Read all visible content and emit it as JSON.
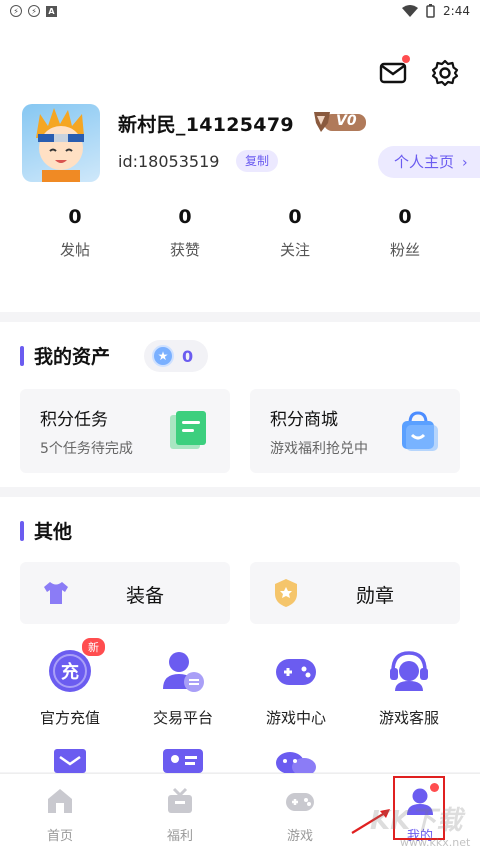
{
  "status_bar": {
    "time": "2:44"
  },
  "profile": {
    "username": "新村民_14125479",
    "vip_label": "V0",
    "uid": "id:18053519",
    "copy_label": "复制",
    "homepage_label": "个人主页",
    "stats": [
      {
        "value": "0",
        "label": "发帖"
      },
      {
        "value": "0",
        "label": "获赞"
      },
      {
        "value": "0",
        "label": "关注"
      },
      {
        "value": "0",
        "label": "粉丝"
      }
    ]
  },
  "assets": {
    "title": "我的资产",
    "coin_value": "0",
    "tiles": [
      {
        "title": "积分任务",
        "subtitle": "5个任务待完成",
        "icon": "task-list-icon"
      },
      {
        "title": "积分商城",
        "subtitle": "游戏福利抢兑中",
        "icon": "shopping-bag-icon"
      }
    ]
  },
  "other": {
    "title": "其他",
    "buttons": [
      {
        "label": "装备",
        "icon": "tshirt-icon"
      },
      {
        "label": "勋章",
        "icon": "medal-icon"
      }
    ],
    "grid": [
      {
        "label": "官方充值",
        "icon": "recharge-icon",
        "badge": "新"
      },
      {
        "label": "交易平台",
        "icon": "trade-icon"
      },
      {
        "label": "游戏中心",
        "icon": "gamepad-icon"
      },
      {
        "label": "游戏客服",
        "icon": "headset-icon"
      }
    ]
  },
  "tabbar": [
    {
      "label": "首页",
      "icon": "home-icon"
    },
    {
      "label": "福利",
      "icon": "gift-icon"
    },
    {
      "label": "游戏",
      "icon": "gamepad-icon"
    },
    {
      "label": "我的",
      "icon": "profile-icon"
    }
  ],
  "watermark": {
    "brand": "KK下载",
    "url": "www.kkx.net"
  },
  "colors": {
    "accent": "#6b5cf0",
    "badge": "#ff4d4f"
  }
}
